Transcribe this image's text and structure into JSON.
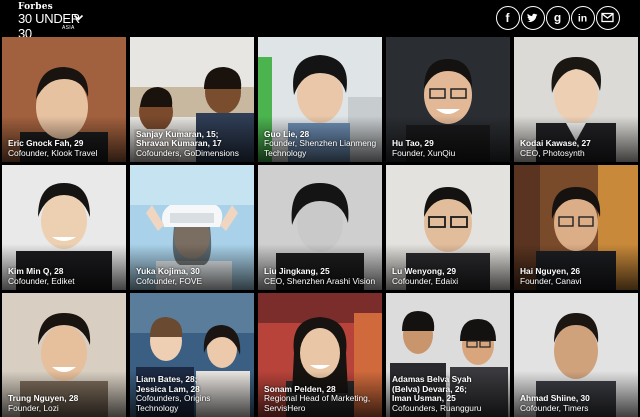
{
  "header": {
    "brand": "Forbes",
    "title": "30 UNDER 30",
    "subtitle": "ASIA",
    "social": [
      {
        "icon": "facebook-icon",
        "glyph": "f"
      },
      {
        "icon": "twitter-icon",
        "glyph": "t"
      },
      {
        "icon": "google-plus-icon",
        "glyph": "g"
      },
      {
        "icon": "linkedin-icon",
        "glyph": "in"
      },
      {
        "icon": "email-icon",
        "glyph": "mail"
      }
    ]
  },
  "honorees": [
    {
      "name": "Eric Gnock Fah, 29",
      "role": "Cofounder, Klook Travel"
    },
    {
      "name": "Sanjay Kumaran, 15;\nShravan Kumaran, 17",
      "role": "Cofounders, GoDimensions"
    },
    {
      "name": "Guo Lie, 28",
      "role": "Founder, Shenzhen Lianmeng\nTechnology"
    },
    {
      "name": "Hu Tao, 29",
      "role": "Founder, XunQiu"
    },
    {
      "name": "Kodai Kawase, 27",
      "role": "CEO, Photosynth"
    },
    {
      "name": "Kim Min Q, 28",
      "role": "Cofounder, Ediket"
    },
    {
      "name": "Yuka Kojima, 30",
      "role": "Cofounder, FOVE"
    },
    {
      "name": "Liu Jingkang, 25",
      "role": "CEO, Shenzhen Arashi Vision"
    },
    {
      "name": "Lu Wenyong, 29",
      "role": "Cofounder, Edaixi"
    },
    {
      "name": "Hai Nguyen, 26",
      "role": "Founder, Canavi"
    },
    {
      "name": "Trung Nguyen, 28",
      "role": "Founder, Lozi"
    },
    {
      "name": "Liam Bates, 28;\nJessica Lam, 28",
      "role": "Cofounders, Origins\nTechnology"
    },
    {
      "name": "Sonam Pelden, 28",
      "role": "Regional Head of Marketing,\nServisHero"
    },
    {
      "name": "Adamas Belva Syah\n(Belva) Devara, 26;\nIman Usman, 25",
      "role": "Cofounders, Ruangguru"
    },
    {
      "name": "Ahmad Shiine, 30",
      "role": "Cofounder, Timers"
    }
  ],
  "colors": {
    "background": "#000000",
    "caption_text": "#ffffff"
  }
}
